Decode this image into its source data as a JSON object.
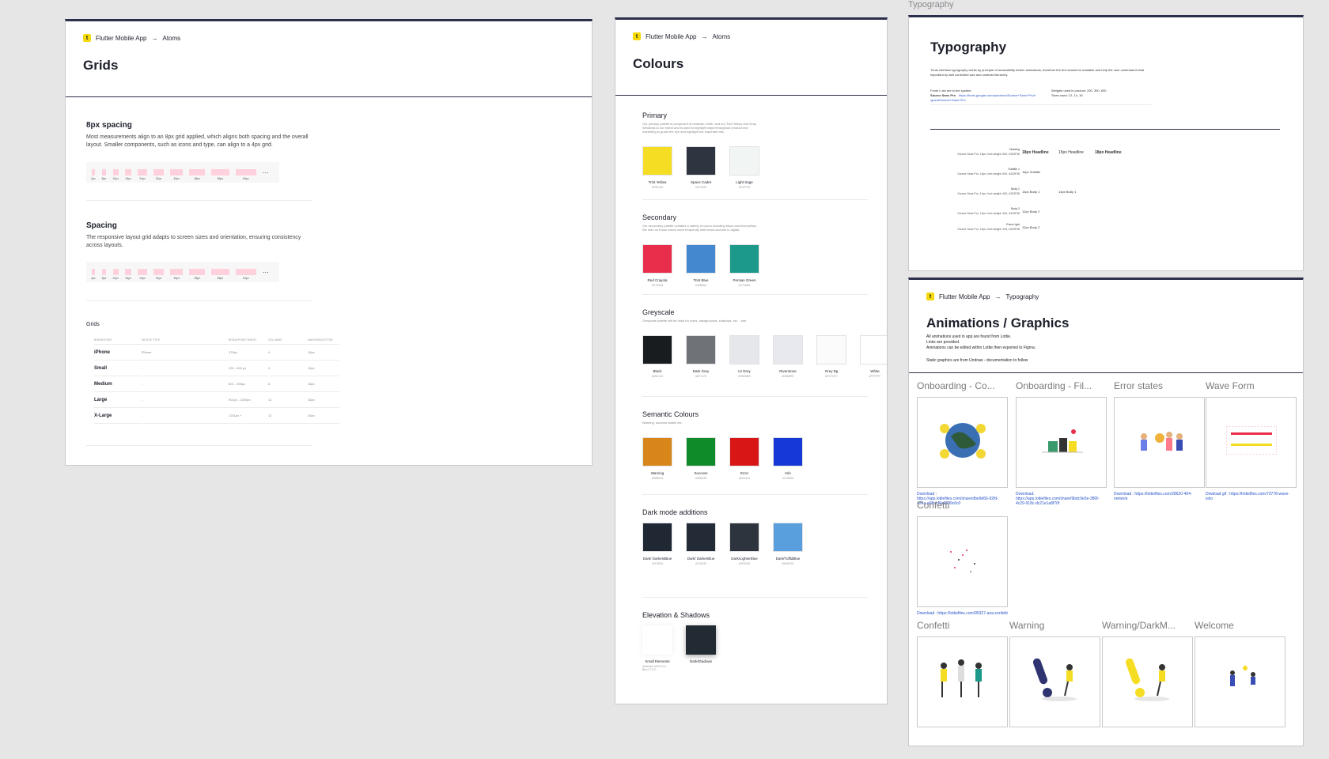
{
  "grids": {
    "breadcrumb_app": "Flutter Mobile App",
    "breadcrumb_arrow": "→",
    "breadcrumb_section": "Atoms",
    "title": "Grids",
    "spacing8": {
      "heading": "8px spacing",
      "body": "Most measurements align to an 8px grid applied, which aligns both spacing and the overall layout. Smaller components, such as icons and type, can align to a 4px grid."
    },
    "spacing": {
      "heading": "Spacing",
      "body": "The responsive layout grid adapts to screen sizes and orientation, ensuring consistency across layouts."
    },
    "rule_labels": [
      "4px",
      "8px",
      "12px",
      "16px",
      "24px",
      "32px",
      "40px",
      "48px",
      "56px",
      "64px"
    ],
    "rule_more": "···",
    "table_title": "Grids",
    "table_headers": [
      "BREAKPOINT",
      "DEVICE TYPE",
      "BREAKPOINT WIDTH",
      "COLUMNS",
      "MARGINS/GUTTER"
    ],
    "table_rows": [
      [
        "iPhone",
        "iPhone",
        "375px",
        "4",
        "16px"
      ],
      [
        "Small",
        "-",
        "320 - 600 px",
        "4",
        "16px"
      ],
      [
        "Medium",
        "-",
        "601 - 900px",
        "8",
        "16px"
      ],
      [
        "Large",
        "-",
        "901px - 1200px",
        "12",
        "16px"
      ],
      [
        "X-Large",
        "-",
        "1201px +",
        "12",
        "24px"
      ]
    ]
  },
  "colours": {
    "breadcrumb_app": "Flutter Mobile App",
    "breadcrumb_arrow": "→",
    "breadcrumb_section": "Atoms",
    "title": "Colours",
    "groups": [
      {
        "name": "Primary",
        "desc": "Our primary palette is comprised of neutrals, white, and our Trint Yellow and Gray Windows to our brand and is used to highlight ways throughout product and marketing to guide the eye and highlight the important bits.",
        "swatches": [
          {
            "name": "Trint Yellow",
            "hex": "#F5E126",
            "color": "#f5dd24"
          },
          {
            "name": "Space Cadet",
            "hex": "#2F3440",
            "color": "#2f3540"
          },
          {
            "name": "Light Sage",
            "hex": "#F1F7F5",
            "color": "#f1f5f3"
          }
        ]
      },
      {
        "name": "Secondary",
        "desc": "Our secondary palette contains a variety of colors including blues and lime/yellow. We lean on these colors more frequently with brand accents in digital.",
        "swatches": [
          {
            "name": "Red Crayola",
            "hex": "#E7304A",
            "color": "#e82e4a"
          },
          {
            "name": "Trint Blue",
            "hex": "#4088D0",
            "color": "#4489d0"
          },
          {
            "name": "Persian Green",
            "hex": "#1C9A8A",
            "color": "#1c998a"
          }
        ]
      },
      {
        "name": "Greyscale",
        "desc": "Greyscale palette will be used for icons, backgrounds, shadows, etc. - see",
        "swatches": [
          {
            "name": "Black",
            "hex": "#181C1E",
            "color": "#181c1e"
          },
          {
            "name": "Dark Grey",
            "hex": "#6F7478",
            "color": "#6f7378"
          },
          {
            "name": "UI Grey",
            "hex": "#E6E6EB",
            "color": "#e6e7eb"
          },
          {
            "name": "Riverstone",
            "hex": "#E6E8EE",
            "color": "#e8e9ee"
          },
          {
            "name": "Grey Bg",
            "hex": "#FCFCFC",
            "color": "#fbfbfb"
          },
          {
            "name": "White",
            "hex": "#FFFFFF",
            "color": "#ffffff"
          }
        ]
      },
      {
        "name": "Semantic Colours",
        "desc": "Warning, success states etc.",
        "swatches": [
          {
            "name": "Warning",
            "hex": "#D8861A",
            "color": "#d8861a"
          },
          {
            "name": "Success",
            "hex": "#0E8C28",
            "color": "#0f8b2a"
          },
          {
            "name": "Error",
            "hex": "#D91414",
            "color": "#d91616"
          },
          {
            "name": "Info",
            "hex": "#1436D6",
            "color": "#1538d6"
          }
        ]
      },
      {
        "name": "Dark mode additions",
        "desc": "",
        "swatches": [
          {
            "name": "Dark/ DarkestBlue",
            "hex": "#1F2833",
            "color": "#1f2833"
          },
          {
            "name": "Dark/ DarkerBlue",
            "hex": "#222A34",
            "color": "#232b36"
          },
          {
            "name": "Dark/LighterBlue",
            "hex": "#2E333D",
            "color": "#2e343e"
          },
          {
            "name": "Dark/TuffidBlue",
            "hex": "#5A9FDD",
            "color": "#5a9fdd"
          }
        ]
      },
      {
        "name": "Elevation & Shadows",
        "desc": "",
        "swatches": [
          {
            "name": "Small Elements",
            "hex": "#ebebeb 100% X:0 Blur:17 S:0",
            "color": "#ffffff"
          },
          {
            "name": "DarkShadows",
            "hex": "",
            "color": "#222a34"
          }
        ]
      }
    ]
  },
  "typography": {
    "frame_label": "Typography",
    "title": "Typography",
    "intro": "Trints interface typography works by principle of accessibility before animations, therefore the text should be readable and help the user understand what important by well controlled size and contrast hierarchy.",
    "font_note_1": "Fonts I use are in the system:",
    "font_note_2": "Source Sans Pro",
    "font_link": "https://fonts.google.com/specimen/Source+Sans+Pro#",
    "font_link_2": "/guest/Source+Sans+Pro",
    "weights": "Weights used in product: 200, 300, 600",
    "sizes": "Sizes used: 12, 14, 16",
    "rows": [
      {
        "label": "Heading",
        "spec": "Source Sans Pro, 18px, font-weight: 600, #333F38",
        "samples": [
          "18px Headline",
          "15px Headline",
          "18px Headline"
        ]
      },
      {
        "label": "Subtitle 1",
        "spec": "Source Sans Pro, 16px, font-weight: 600, #333F38",
        "samples": [
          "16px Subtitle"
        ]
      },
      {
        "label": "Body 1",
        "spec": "Source Sans Pro, 14px, font-weight: 400, #333F38",
        "samples": [
          "14px Body 1",
          "14px Body 1"
        ]
      },
      {
        "label": "Body 2",
        "spec": "Source Sans Pro, 12px, font-weight: 400, #333F38",
        "samples": [
          "12px Body 2"
        ]
      },
      {
        "label": "Extra Light",
        "spec": "Source Sans Pro, 10px, font-weight: 200, #333F38",
        "samples": [
          "12px Body 2"
        ]
      }
    ]
  },
  "animations": {
    "breadcrumb_app": "Flutter Mobile App",
    "breadcrumb_arrow": "→",
    "breadcrumb_section": "Typography",
    "title": "Animations / Graphics",
    "lines": [
      "All animations used in app are found from Lottie.",
      "Links are provided.",
      "Animations can be edited within Lottie then exported to Figma."
    ],
    "static_note": "Static graphics are from Undraw - documentation to follow",
    "cards": [
      {
        "title": "Onboarding - Co...",
        "caption": "Download : https://app.lottiefiles.com/share/dbe9d66-92fd-426a-a6fb-cf9a9899c6c0"
      },
      {
        "title": "Onboarding - Fil...",
        "caption": "Download: https://app.lottiefiles.com/share/9bdc9e5e-380f-4c29-918c-dc21e1a8f70f"
      },
      {
        "title": "Error states",
        "caption": "Download : https://lottiefiles.com/28620-404-network"
      },
      {
        "title": "Wave Form",
        "caption": "Dowload gif : https://lottiefiles.com/73778-wave-solo"
      },
      {
        "title": "Confetti",
        "caption": "Download : https://lottiefiles.com/95327-aoa-confetti"
      },
      {
        "title": "Confetti",
        "caption": ""
      },
      {
        "title": "Warning",
        "caption": ""
      },
      {
        "title": "Warning/DarkM...",
        "caption": ""
      },
      {
        "title": "Welcome",
        "caption": ""
      }
    ]
  }
}
